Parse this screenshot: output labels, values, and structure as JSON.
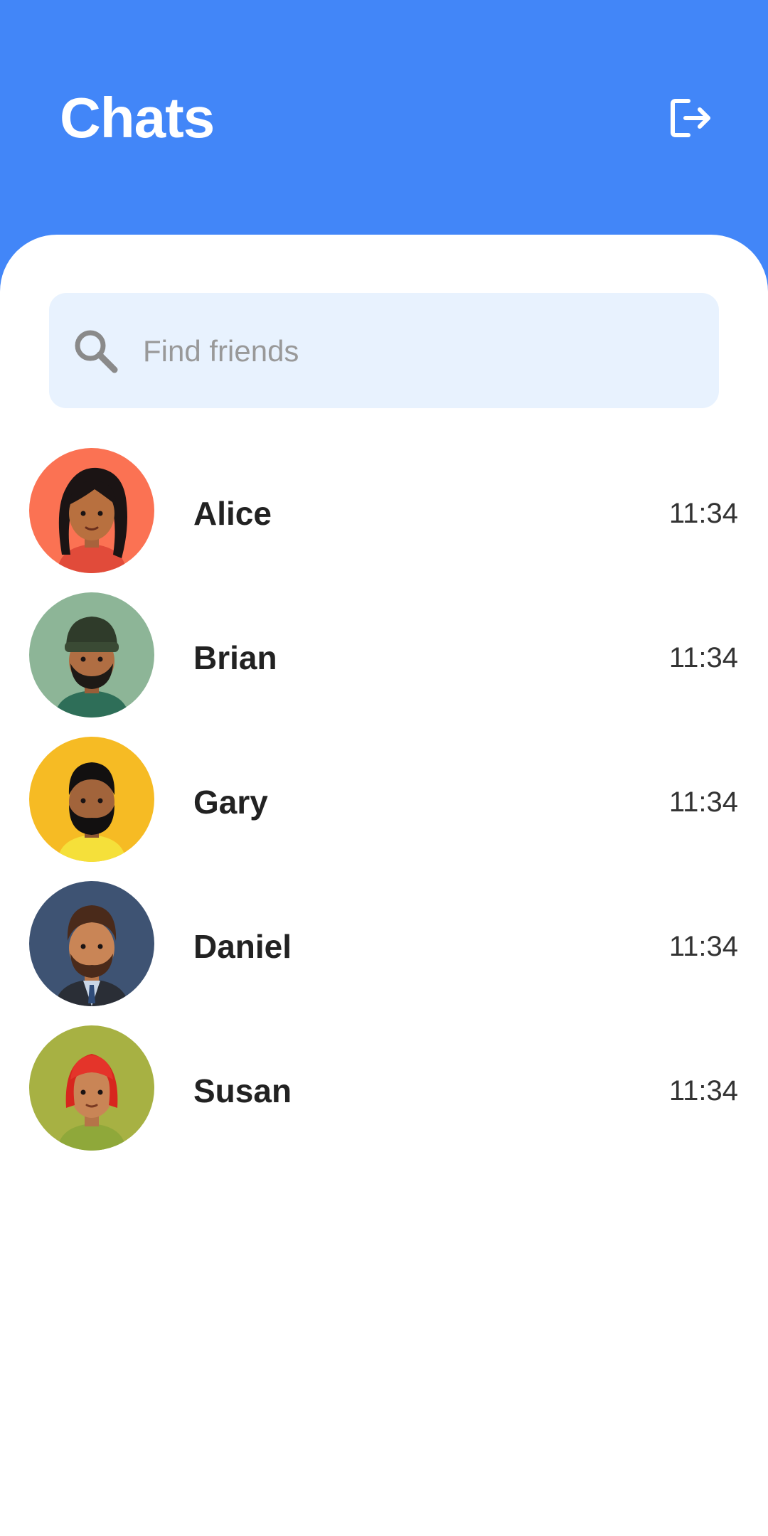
{
  "header": {
    "title": "Chats",
    "logout_icon": "logout-icon",
    "background_color": "#4286F8"
  },
  "search": {
    "placeholder": "Find friends",
    "value": "",
    "icon": "search-icon",
    "background_color": "#E8F2FE"
  },
  "chats": [
    {
      "name": "Alice",
      "time": "11:34",
      "avatar_bg": "#FB7253",
      "avatar_icon": "avatar-alice-icon"
    },
    {
      "name": "Brian",
      "time": "11:34",
      "avatar_bg": "#8DB597",
      "avatar_icon": "avatar-brian-icon"
    },
    {
      "name": "Gary",
      "time": "11:34",
      "avatar_bg": "#F6BB24",
      "avatar_icon": "avatar-gary-icon"
    },
    {
      "name": "Daniel",
      "time": "11:34",
      "avatar_bg": "#3E5373",
      "avatar_icon": "avatar-daniel-icon"
    },
    {
      "name": "Susan",
      "time": "11:34",
      "avatar_bg": "#A7B143",
      "avatar_icon": "avatar-susan-icon"
    }
  ]
}
